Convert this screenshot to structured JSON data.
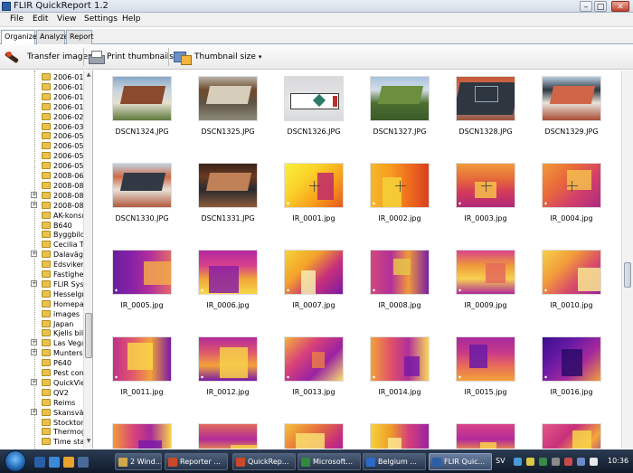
{
  "window": {
    "title": "FLIR QuickReport 1.2",
    "minimize": "–",
    "maximize": "□",
    "close": "✕"
  },
  "menu": [
    "File",
    "Edit",
    "View",
    "Settings",
    "Help"
  ],
  "tabs": [
    {
      "label": "Organize",
      "active": true
    },
    {
      "label": "Analyze",
      "active": false
    },
    {
      "label": "Report",
      "active": false
    }
  ],
  "toolbar": {
    "transfer_label": "Transfer images",
    "print_label": "Print thumbnails",
    "thumbsize_label": "Thumbnail size",
    "dropdown_glyph": "▾"
  },
  "tree": {
    "items": [
      {
        "label": "2006-01-(",
        "expander": false
      },
      {
        "label": "2006-01-2",
        "expander": false
      },
      {
        "label": "2006-01-2",
        "expander": false
      },
      {
        "label": "2006-01-2",
        "expander": false
      },
      {
        "label": "2006-02-0",
        "expander": false
      },
      {
        "label": "2006-03-1",
        "expander": false
      },
      {
        "label": "2006-05-2",
        "expander": false
      },
      {
        "label": "2006-05-2",
        "expander": false
      },
      {
        "label": "2006-05-1",
        "expander": false
      },
      {
        "label": "2006-05-1",
        "expander": false
      },
      {
        "label": "2008-06-2",
        "expander": false
      },
      {
        "label": "2008-08-0",
        "expander": false
      },
      {
        "label": "2008-08-2",
        "expander": true
      },
      {
        "label": "2008-08-2",
        "expander": true
      },
      {
        "label": "AK-konsu",
        "expander": false
      },
      {
        "label": "B640",
        "expander": false
      },
      {
        "label": "Byggbilde",
        "expander": false
      },
      {
        "label": "Cecilia Tr",
        "expander": false
      },
      {
        "label": "Dalaväge",
        "expander": true
      },
      {
        "label": "Edsviken",
        "expander": false
      },
      {
        "label": "Fastighets",
        "expander": false
      },
      {
        "label": "FLIR Syst",
        "expander": true
      },
      {
        "label": "Hesselgre",
        "expander": false
      },
      {
        "label": "Homepag",
        "expander": false
      },
      {
        "label": "images",
        "expander": false
      },
      {
        "label": "Japan",
        "expander": false
      },
      {
        "label": "Kjells bilde",
        "expander": false
      },
      {
        "label": "Las Vega",
        "expander": true
      },
      {
        "label": "Munters 2",
        "expander": true
      },
      {
        "label": "P640",
        "expander": false
      },
      {
        "label": "Pest cont",
        "expander": false
      },
      {
        "label": "QuickView",
        "expander": true
      },
      {
        "label": "QV2",
        "expander": false
      },
      {
        "label": "Reims",
        "expander": false
      },
      {
        "label": "Skansväg",
        "expander": true
      },
      {
        "label": "Stockton",
        "expander": false
      },
      {
        "label": "Thermogr",
        "expander": false
      },
      {
        "label": "Time stan",
        "expander": false
      }
    ],
    "scroll_up": "▲",
    "scroll_down": "▼"
  },
  "thumbnails": [
    {
      "name": "DSCN1324.JPG",
      "kind": "photo",
      "palette": [
        "#87a8c8",
        "#c8d4de",
        "#8a4a2c",
        "#e6e0d0",
        "#5d7a3c"
      ]
    },
    {
      "name": "DSCN1325.JPG",
      "kind": "photo",
      "palette": [
        "#b7b2a6",
        "#6e4a2a",
        "#d6cdbb",
        "#5f5444",
        "#8d8a7a"
      ]
    },
    {
      "name": "DSCN1326.JPG",
      "kind": "sign",
      "palette": [
        "#d8d9dc",
        "#e7e7e9",
        "#3a3a3a",
        "#2c7b6a",
        "#c0302a"
      ]
    },
    {
      "name": "DSCN1327.JPG",
      "kind": "photo",
      "palette": [
        "#a9c2de",
        "#d4dfe8",
        "#6b8f3e",
        "#4d7030",
        "#3a5a2a"
      ]
    },
    {
      "name": "DSCN1328.JPG",
      "kind": "roof",
      "palette": [
        "#c45a3a",
        "#d86c4a",
        "#2e3640",
        "#95a7b8",
        "#a0523a"
      ]
    },
    {
      "name": "DSCN1329.JPG",
      "kind": "photo",
      "palette": [
        "#b9cde0",
        "#2e3640",
        "#d06648",
        "#e8e4dc",
        "#a84c34"
      ]
    },
    {
      "name": "DSCN1330.JPG",
      "kind": "photo",
      "palette": [
        "#c0d2e2",
        "#cf6a48",
        "#303944",
        "#e6e2d8",
        "#b25a3e"
      ]
    },
    {
      "name": "DSCN1331.JPG",
      "kind": "interior",
      "palette": [
        "#3a2418",
        "#6a3a22",
        "#c08058",
        "#2a2a2e",
        "#8a5a3a"
      ]
    },
    {
      "name": "IR_0001.jpg",
      "kind": "ir",
      "palette": [
        "#f7f03a",
        "#fbd22a",
        "#f7a21c",
        "#e8581e",
        "#c02a6a"
      ]
    },
    {
      "name": "IR_0002.jpg",
      "kind": "ir",
      "palette": [
        "#f6b82a",
        "#f79a22",
        "#ef6e1e",
        "#d8401e",
        "#f3d23a"
      ]
    },
    {
      "name": "IR_0003.jpg",
      "kind": "ir",
      "palette": [
        "#f09a3a",
        "#e66a3a",
        "#d43a5a",
        "#b02a7a",
        "#f5c04a"
      ]
    },
    {
      "name": "IR_0004.jpg",
      "kind": "ir",
      "palette": [
        "#f29a3a",
        "#e86a3a",
        "#d2406a",
        "#ad2a82",
        "#f4be4c"
      ]
    },
    {
      "name": "IR_0005.jpg",
      "kind": "ir",
      "palette": [
        "#6a1ea0",
        "#8a22a6",
        "#b4309a",
        "#e06a6a",
        "#f3a84a"
      ]
    },
    {
      "name": "IR_0006.jpg",
      "kind": "ir",
      "palette": [
        "#b32aa2",
        "#d8408a",
        "#f0a43a",
        "#f7d846",
        "#8a1ea6"
      ]
    },
    {
      "name": "IR_0007.jpg",
      "kind": "ir",
      "palette": [
        "#f6d23a",
        "#f4a22a",
        "#c8307a",
        "#7a1aa2",
        "#f7f0b0"
      ]
    },
    {
      "name": "IR_0008.jpg",
      "kind": "ir",
      "palette": [
        "#d24a7a",
        "#b2309a",
        "#f09a3a",
        "#7a1ea6",
        "#e8c24a"
      ]
    },
    {
      "name": "IR_0009.jpg",
      "kind": "ir",
      "palette": [
        "#d8448a",
        "#ef9a3a",
        "#f7d050",
        "#b12a9a",
        "#e66a5a"
      ]
    },
    {
      "name": "IR_0010.jpg",
      "kind": "ir",
      "palette": [
        "#f5d24a",
        "#f29a3a",
        "#d84a6a",
        "#9a22a0",
        "#f8e890"
      ]
    },
    {
      "name": "IR_0011.jpg",
      "kind": "ir",
      "palette": [
        "#c0308a",
        "#e25a6a",
        "#f3a23a",
        "#7a1aa6",
        "#f8d44a"
      ]
    },
    {
      "name": "IR_0012.jpg",
      "kind": "ir",
      "palette": [
        "#b22a9a",
        "#e05a6a",
        "#f4a23a",
        "#7a1aa6",
        "#f7d04a"
      ]
    },
    {
      "name": "IR_0013.jpg",
      "kind": "ir",
      "palette": [
        "#f4b23a",
        "#d8407a",
        "#9a22a2",
        "#f7e070",
        "#e87a4a"
      ]
    },
    {
      "name": "IR_0014.jpg",
      "kind": "ir",
      "palette": [
        "#f2a23a",
        "#e0506a",
        "#b0309a",
        "#f8d858",
        "#7a1aa6"
      ]
    },
    {
      "name": "IR_0015.jpg",
      "kind": "ir",
      "palette": [
        "#a62a9e",
        "#c83a8a",
        "#e86a5a",
        "#f2a23a",
        "#6a1aa6"
      ]
    },
    {
      "name": "IR_0016.jpg",
      "kind": "ir",
      "palette": [
        "#3a0e8a",
        "#6a1aa6",
        "#a82a9a",
        "#f0a03a",
        "#2a0a6a"
      ]
    },
    {
      "name": "",
      "kind": "ir",
      "palette": [
        "#f29a3a",
        "#d8447a",
        "#a82a9a",
        "#f6d24a",
        "#7a1aa6"
      ]
    },
    {
      "name": "",
      "kind": "ir",
      "palette": [
        "#e06a5a",
        "#b22a9a",
        "#f3a23a",
        "#7a1aa6",
        "#f6d04a"
      ]
    },
    {
      "name": "",
      "kind": "ir",
      "palette": [
        "#f6c23a",
        "#e8743a",
        "#c8307a",
        "#8a1aa6",
        "#f8e070"
      ]
    },
    {
      "name": "",
      "kind": "ir",
      "palette": [
        "#f6d23a",
        "#f09a2a",
        "#d4407a",
        "#9a22a2",
        "#fae890"
      ]
    },
    {
      "name": "",
      "kind": "ir",
      "palette": [
        "#d8448a",
        "#b42a9a",
        "#f2a03a",
        "#7a1aa6",
        "#f8d04a"
      ]
    },
    {
      "name": "",
      "kind": "ir",
      "palette": [
        "#e2588a",
        "#c8307a",
        "#f4a83a",
        "#8a1ea6",
        "#f7d44a"
      ]
    }
  ],
  "taskbar": {
    "buttons": [
      {
        "label": "2 Wind...",
        "color": "#d0a84a",
        "active": false
      },
      {
        "label": "Reporter ...",
        "color": "#c84a2a",
        "active": false
      },
      {
        "label": "QuickRep...",
        "color": "#c84a2a",
        "active": false
      },
      {
        "label": "Microsoft...",
        "color": "#2f8a3a",
        "active": false
      },
      {
        "label": "Belgium ...",
        "color": "#2a6ac8",
        "active": false
      },
      {
        "label": "FLIR Quic...",
        "color": "#2a5fa8",
        "active": true
      }
    ],
    "language": "SV",
    "clock": "10:36"
  }
}
